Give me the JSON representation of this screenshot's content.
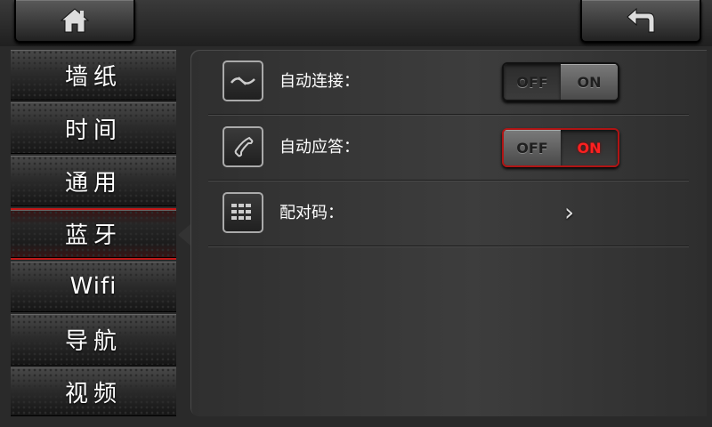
{
  "header": {
    "home_icon": "home-icon",
    "back_icon": "back-arrow-icon"
  },
  "sidebar": {
    "items": [
      {
        "label": "墙纸",
        "active": false
      },
      {
        "label": "时间",
        "active": false
      },
      {
        "label": "通用",
        "active": false
      },
      {
        "label": "蓝牙",
        "active": true
      },
      {
        "label": "Wifi",
        "active": false
      },
      {
        "label": "导航",
        "active": false
      },
      {
        "label": "视频",
        "active": false
      }
    ]
  },
  "settings": {
    "auto_connect": {
      "label": "自动连接：",
      "icon": "connect-icon",
      "off_label": "OFF",
      "on_label": "ON",
      "state": "off"
    },
    "auto_answer": {
      "label": "自动应答：",
      "icon": "phone-icon",
      "off_label": "OFF",
      "on_label": "ON",
      "state": "on"
    },
    "pair_code": {
      "label": "配对码：",
      "icon": "keypad-icon",
      "chevron": "›"
    }
  },
  "colors": {
    "accent_red": "#ff2020",
    "active_border": "#c01818"
  }
}
